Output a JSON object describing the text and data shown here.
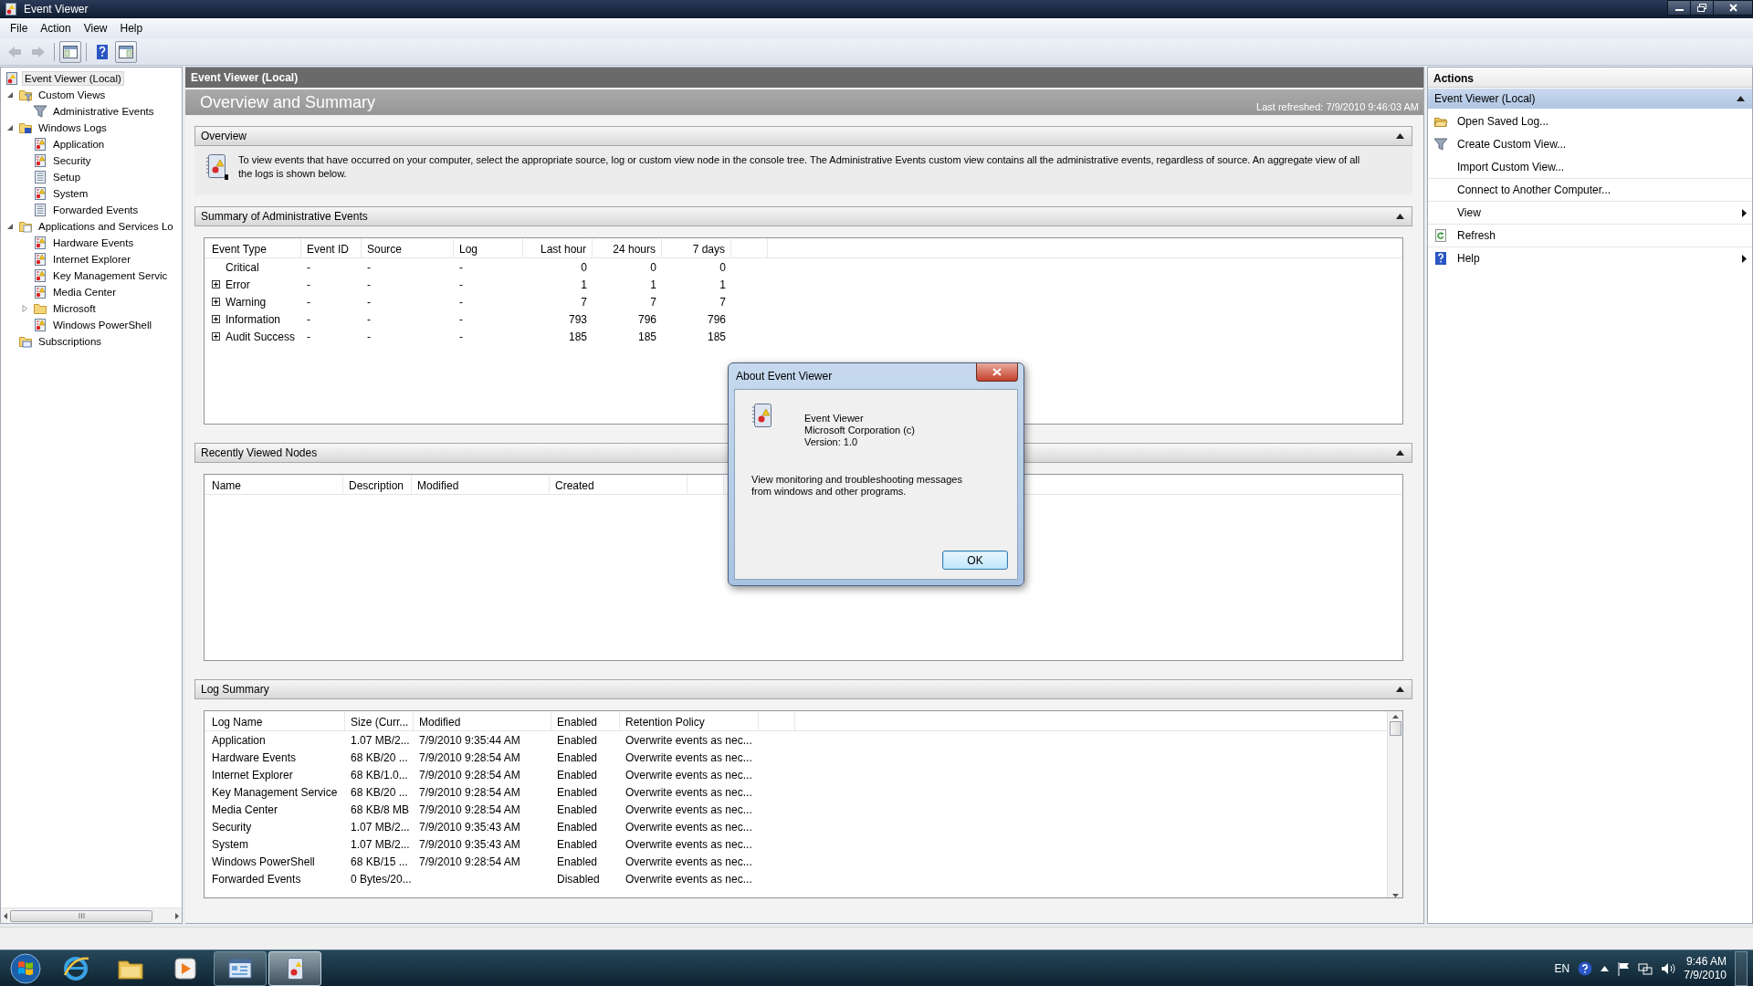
{
  "window": {
    "title": "Event Viewer"
  },
  "menu": [
    "File",
    "Action",
    "View",
    "Help"
  ],
  "toolbar": [
    {
      "kind": "back",
      "disabled": true
    },
    {
      "kind": "forward",
      "disabled": true
    },
    {
      "kind": "tree-pane",
      "on": true
    },
    {
      "kind": "help",
      "on": false
    },
    {
      "kind": "action-pane",
      "on": true
    }
  ],
  "tree": [
    {
      "label": "Event Viewer (Local)",
      "kind": "root",
      "selected": true,
      "children": [
        {
          "label": "Custom Views",
          "kind": "folder-filter",
          "selected": false,
          "expanded": true,
          "children": [
            {
              "label": "Administrative Events",
              "kind": "filter",
              "selected": false
            }
          ]
        },
        {
          "label": "Windows Logs",
          "kind": "folder-logs",
          "selected": false,
          "expanded": true,
          "children": [
            {
              "label": "Application",
              "kind": "log",
              "selected": false
            },
            {
              "label": "Security",
              "kind": "log",
              "selected": false
            },
            {
              "label": "Setup",
              "kind": "log-plain",
              "selected": false
            },
            {
              "label": "System",
              "kind": "log",
              "selected": false
            },
            {
              "label": "Forwarded Events",
              "kind": "log-plain",
              "selected": false
            }
          ]
        },
        {
          "label": "Applications and Services Lo",
          "kind": "folder-plain",
          "selected": false,
          "expanded": true,
          "children": [
            {
              "label": "Hardware Events",
              "kind": "log",
              "selected": false
            },
            {
              "label": "Internet Explorer",
              "kind": "log",
              "selected": false
            },
            {
              "label": "Key Management Servic",
              "kind": "log",
              "selected": false
            },
            {
              "label": "Media Center",
              "kind": "log",
              "selected": false
            },
            {
              "label": "Microsoft",
              "kind": "folder",
              "selected": false,
              "expanded": false
            },
            {
              "label": "Windows PowerShell",
              "kind": "log",
              "selected": false
            }
          ]
        },
        {
          "label": "Subscriptions",
          "kind": "subscriptions",
          "selected": false
        }
      ]
    }
  ],
  "center": {
    "header": "Event Viewer (Local)",
    "title": "Overview and Summary",
    "last_refreshed": "Last refreshed: 7/9/2010 9:46:03 AM",
    "overview": {
      "title": "Overview",
      "text": "To view events that have occurred on your computer, select the appropriate source, log or custom view node in the console tree. The Administrative Events custom view contains all the administrative events, regardless of source. An aggregate view of all the logs is shown below."
    },
    "summary": {
      "title": "Summary of Administrative Events",
      "columns": [
        "Event Type",
        "Event ID",
        "Source",
        "Log",
        "Last hour",
        "24 hours",
        "7 days"
      ],
      "rows": [
        {
          "expandable": false,
          "cells": [
            "Critical",
            "-",
            "-",
            "-",
            "0",
            "0",
            "0"
          ]
        },
        {
          "expandable": true,
          "cells": [
            "Error",
            "-",
            "-",
            "-",
            "1",
            "1",
            "1"
          ]
        },
        {
          "expandable": true,
          "cells": [
            "Warning",
            "-",
            "-",
            "-",
            "7",
            "7",
            "7"
          ]
        },
        {
          "expandable": true,
          "cells": [
            "Information",
            "-",
            "-",
            "-",
            "793",
            "796",
            "796"
          ]
        },
        {
          "expandable": true,
          "cells": [
            "Audit Success",
            "-",
            "-",
            "-",
            "185",
            "185",
            "185"
          ]
        }
      ]
    },
    "recent": {
      "title": "Recently Viewed Nodes",
      "columns": [
        "Name",
        "Description",
        "Modified",
        "Created"
      ]
    },
    "log_summary": {
      "title": "Log Summary",
      "columns": [
        "Log Name",
        "Size (Curr...",
        "Modified",
        "Enabled",
        "Retention Policy"
      ],
      "rows": [
        [
          "Application",
          "1.07 MB/2...",
          "7/9/2010 9:35:44 AM",
          "Enabled",
          "Overwrite events as nec..."
        ],
        [
          "Hardware Events",
          "68 KB/20 ...",
          "7/9/2010 9:28:54 AM",
          "Enabled",
          "Overwrite events as nec..."
        ],
        [
          "Internet Explorer",
          "68 KB/1.0...",
          "7/9/2010 9:28:54 AM",
          "Enabled",
          "Overwrite events as nec..."
        ],
        [
          "Key Management Service",
          "68 KB/20 ...",
          "7/9/2010 9:28:54 AM",
          "Enabled",
          "Overwrite events as nec..."
        ],
        [
          "Media Center",
          "68 KB/8 MB",
          "7/9/2010 9:28:54 AM",
          "Enabled",
          "Overwrite events as nec..."
        ],
        [
          "Security",
          "1.07 MB/2...",
          "7/9/2010 9:35:43 AM",
          "Enabled",
          "Overwrite events as nec..."
        ],
        [
          "System",
          "1.07 MB/2...",
          "7/9/2010 9:35:43 AM",
          "Enabled",
          "Overwrite events as nec..."
        ],
        [
          "Windows PowerShell",
          "68 KB/15 ...",
          "7/9/2010 9:28:54 AM",
          "Enabled",
          "Overwrite events as nec..."
        ],
        [
          "Forwarded Events",
          "0 Bytes/20...",
          "",
          "Disabled",
          "Overwrite events as nec..."
        ]
      ]
    }
  },
  "actions": {
    "title": "Actions",
    "group": "Event Viewer (Local)",
    "expanded": true,
    "items": [
      {
        "label": "Open Saved Log...",
        "kind": "open",
        "submenu": false
      },
      {
        "label": "Create Custom View...",
        "kind": "filter",
        "submenu": false
      },
      {
        "label": "Import Custom View...",
        "kind": "none",
        "submenu": false
      },
      {
        "label": "Connect to Another Computer...",
        "kind": "none",
        "submenu": false
      },
      {
        "label": "View",
        "kind": "none",
        "submenu": true
      },
      {
        "label": "Refresh",
        "kind": "refresh",
        "submenu": false
      },
      {
        "label": "Help",
        "kind": "help",
        "submenu": true
      }
    ]
  },
  "dialog": {
    "title": "About Event Viewer",
    "lines": [
      "Event Viewer",
      "Microsoft Corporation (c)",
      "Version: 1.0"
    ],
    "description": "View monitoring and troubleshooting messages from windows and other programs.",
    "button": "OK"
  },
  "taskbar": {
    "apps": [
      {
        "kind": "browser",
        "running": false,
        "selected": false
      },
      {
        "kind": "explorer",
        "running": false,
        "selected": false
      },
      {
        "kind": "media",
        "running": false,
        "selected": false
      },
      {
        "kind": "window",
        "running": true,
        "selected": false
      },
      {
        "kind": "event-viewer",
        "running": true,
        "selected": true
      }
    ],
    "language": "EN",
    "time": "9:46 AM",
    "date": "7/9/2010"
  }
}
